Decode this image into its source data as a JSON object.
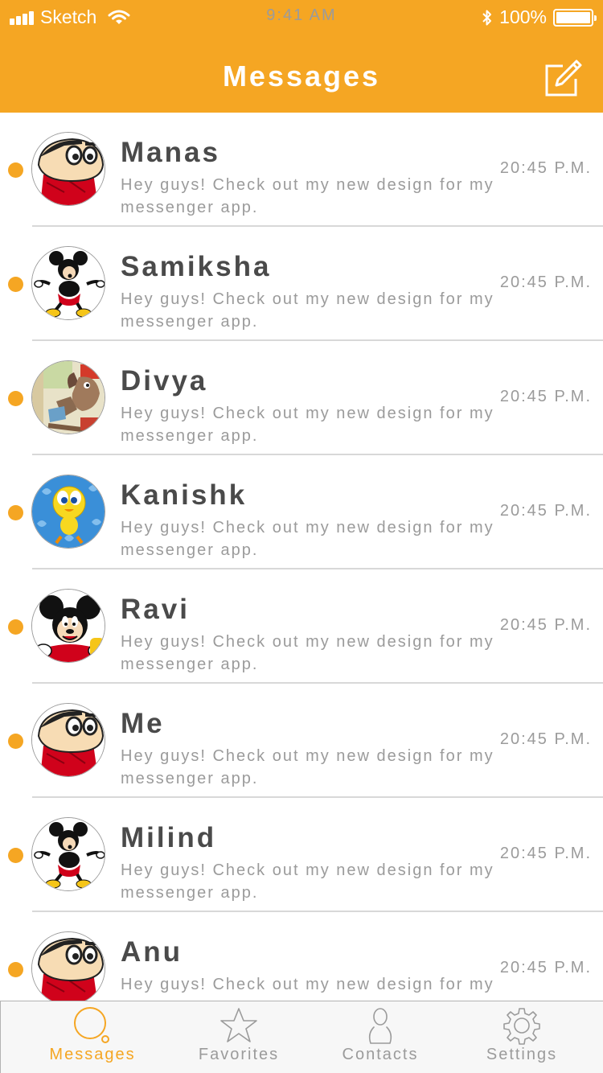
{
  "status_bar": {
    "carrier": "Sketch",
    "time": "9:41 AM",
    "battery": "100%"
  },
  "header": {
    "title": "Messages",
    "compose_icon": "compose-icon"
  },
  "colors": {
    "accent": "#F5A623",
    "name_text": "#4A4A4A",
    "secondary_text": "#9B9B9B",
    "divider": "#D8D8D8"
  },
  "conversations": [
    {
      "name": "Manas",
      "message": "Hey guys! Check out my new design for my messenger app.",
      "time": "20:45 P.M.",
      "avatar": "shinchan-avatar",
      "unread": true
    },
    {
      "name": "Samiksha",
      "message": "Hey guys! Check out my new design for my messenger app.",
      "time": "20:45 P.M.",
      "avatar": "mickey-avatar",
      "unread": true
    },
    {
      "name": "Divya",
      "message": "Hey guys! Check out my new design for my messenger app.",
      "time": "20:45 P.M.",
      "avatar": "cartoon-avatar",
      "unread": true
    },
    {
      "name": "Kanishk",
      "message": "Hey guys! Check out my new design for my messenger app.",
      "time": "20:45 P.M.",
      "avatar": "tweety-avatar",
      "unread": true
    },
    {
      "name": "Ravi",
      "message": "Hey guys! Check out my new design for my messenger app.",
      "time": "20:45 P.M.",
      "avatar": "mickey-face-avatar",
      "unread": true
    },
    {
      "name": "Me",
      "message": "Hey guys! Check out my new design for my messenger app.",
      "time": "20:45 P.M.",
      "avatar": "shinchan-avatar",
      "unread": true
    },
    {
      "name": "Milind",
      "message": "Hey guys! Check out my new design for my messenger app.",
      "time": "20:45 P.M.",
      "avatar": "mickey-avatar",
      "unread": true
    },
    {
      "name": "Anu",
      "message": "Hey guys! Check out my new design for my messenger app.",
      "time": "20:45 P.M.",
      "avatar": "shinchan-avatar",
      "unread": true
    }
  ],
  "tabbar": {
    "tabs": [
      {
        "label": "Messages",
        "icon": "chat-bubble-icon",
        "active": true
      },
      {
        "label": "Favorites",
        "icon": "star-icon",
        "active": false
      },
      {
        "label": "Contacts",
        "icon": "person-icon",
        "active": false
      },
      {
        "label": "Settings",
        "icon": "gear-icon",
        "active": false
      }
    ]
  }
}
